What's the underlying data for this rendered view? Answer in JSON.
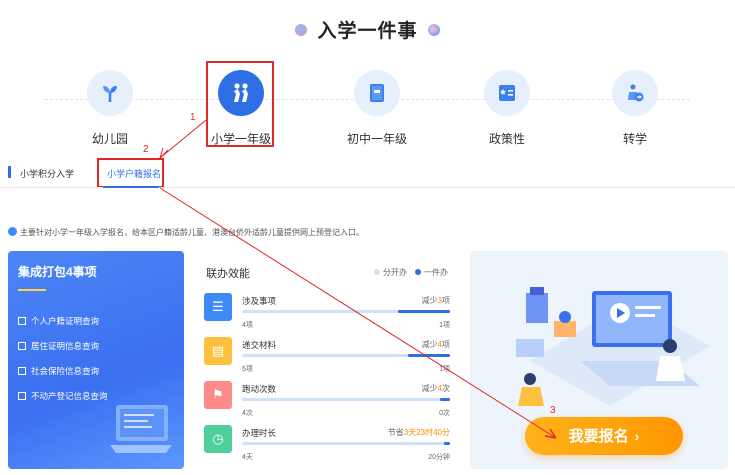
{
  "page": {
    "title": "入学一件事"
  },
  "categories": [
    {
      "label": "幼儿园",
      "icon": "sprout-icon",
      "active": false
    },
    {
      "label": "小学一年级",
      "icon": "students-icon",
      "active": true
    },
    {
      "label": "初中一年级",
      "icon": "book-icon",
      "active": false
    },
    {
      "label": "政策性",
      "icon": "star-document-icon",
      "active": false
    },
    {
      "label": "转学",
      "icon": "transfer-icon",
      "active": false
    }
  ],
  "tabs": [
    {
      "label": "小学积分入学",
      "active": false
    },
    {
      "label": "小学户籍报名",
      "active": true
    }
  ],
  "notice": "主要针对小学一年级入学报名，给本区户籍适龄儿童、港澳台侨外适龄儿童提供网上预登记入口。",
  "package_card": {
    "title": "集成打包4事项",
    "items": [
      {
        "label": "个人户籍证明查询",
        "icon": "id-card-icon"
      },
      {
        "label": "居住证明信息查询",
        "icon": "building-icon"
      },
      {
        "label": "社会保险信息查询",
        "icon": "document-icon"
      },
      {
        "label": "不动产登记信息查询",
        "icon": "house-icon"
      }
    ]
  },
  "efficiency": {
    "title": "联办效能",
    "legend": {
      "separate": "分开办",
      "combined": "一件办"
    },
    "rows": [
      {
        "name": "涉及事项",
        "saving_prefix": "减少",
        "saving_value": "3",
        "saving_suffix": "项",
        "left_value": "4项",
        "right_value": "1项",
        "icon": "list-icon",
        "combined_ratio": 0.25
      },
      {
        "name": "递交材料",
        "saving_prefix": "减少",
        "saving_value": "4",
        "saving_suffix": "项",
        "left_value": "5项",
        "right_value": "1项",
        "icon": "file-icon",
        "combined_ratio": 0.2
      },
      {
        "name": "跑动次数",
        "saving_prefix": "减少",
        "saving_value": "4",
        "saving_suffix": "次",
        "left_value": "4次",
        "right_value": "0次",
        "icon": "runner-icon",
        "combined_ratio": 0.05
      },
      {
        "name": "办理时长",
        "saving_prefix": "节省",
        "saving_value": "3天23时40分",
        "saving_suffix": "",
        "left_value": "4天",
        "right_value": "20分钟",
        "icon": "clock-icon",
        "combined_ratio": 0.03
      }
    ]
  },
  "apply_button": {
    "label": "我要报名",
    "icon": "chevron-right-icon"
  },
  "annotations": [
    "1",
    "2",
    "3"
  ],
  "colors": {
    "primary": "#2f6fe6",
    "accent": "#ff9700",
    "annotation": "#e3262a"
  }
}
